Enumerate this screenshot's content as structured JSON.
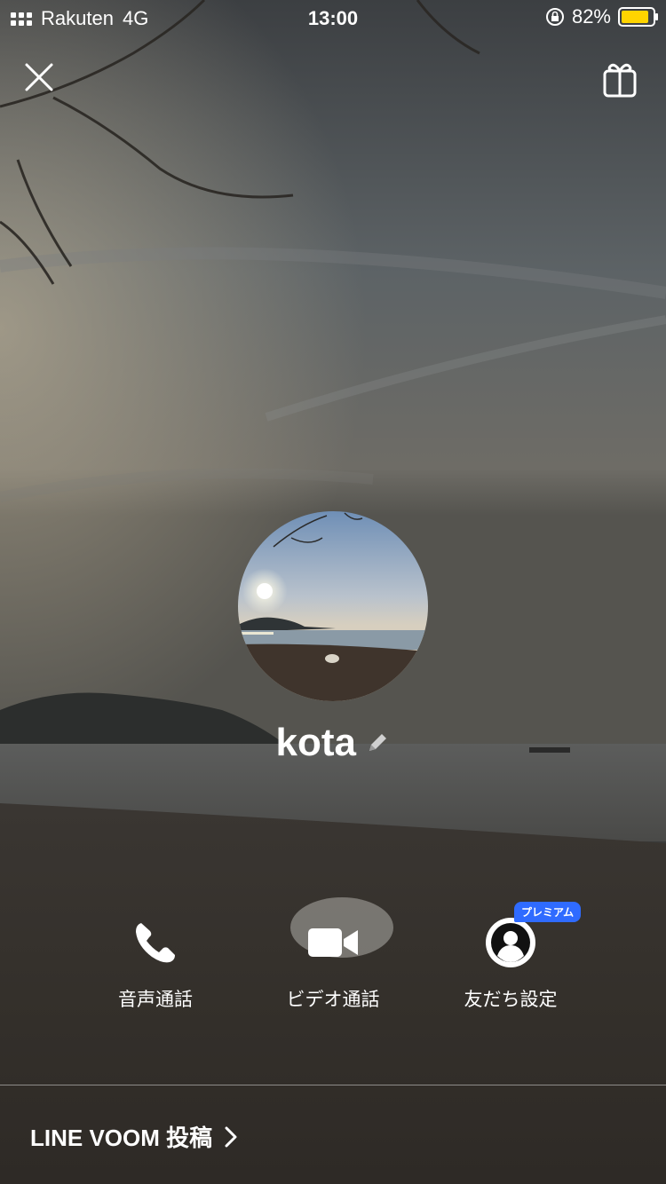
{
  "status_bar": {
    "carrier": "Rakuten",
    "network": "4G",
    "time": "13:00",
    "battery": "82%",
    "battery_color": "#ffd400"
  },
  "header": {
    "close_icon": "close-icon",
    "gift_icon": "gift-icon"
  },
  "profile": {
    "name": "kota",
    "edit_icon": "pencil-icon"
  },
  "actions": [
    {
      "label": "音声通話",
      "icon": "phone-icon"
    },
    {
      "label": "ビデオ通話",
      "icon": "video-camera-icon"
    },
    {
      "label": "友だち設定",
      "icon": "person-icon",
      "badge": "プレミアム"
    }
  ],
  "footer": {
    "voom_label": "LINE VOOM 投稿"
  },
  "colors": {
    "badge": "#2f6bff"
  }
}
